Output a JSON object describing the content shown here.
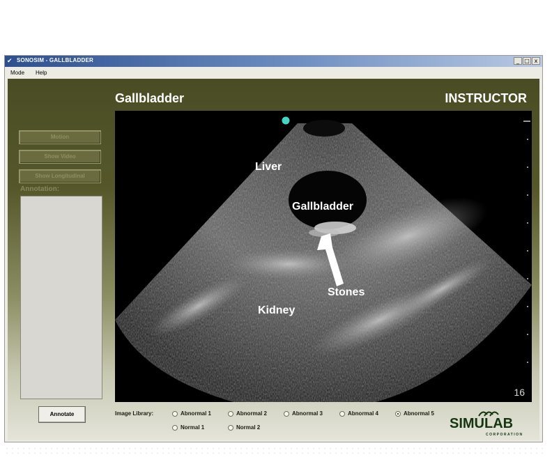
{
  "window": {
    "title": "SONOSIM - GALLBLADDER",
    "controls": {
      "minimize": "_",
      "maximize": "□",
      "close": "x"
    }
  },
  "menu": {
    "items": [
      "Mode",
      "Help"
    ]
  },
  "header": {
    "title": "Gallbladder",
    "mode": "INSTRUCTOR"
  },
  "sidebar": {
    "buttons": [
      "Motion",
      "Show Video",
      "Show Longitudinal"
    ],
    "annotation_label": "Annotation:"
  },
  "annotate_button": "Annotate",
  "ultrasound": {
    "labels": {
      "liver": "Liver",
      "gallbladder": "Gallbladder",
      "stones": "Stones",
      "kidney": "Kidney"
    },
    "frame_number": "16"
  },
  "image_library": {
    "label": "Image Library:",
    "options": [
      {
        "label": "Abnormal 1",
        "selected": false
      },
      {
        "label": "Abnormal 2",
        "selected": false
      },
      {
        "label": "Abnormal 3",
        "selected": false
      },
      {
        "label": "Abnormal 4",
        "selected": false
      },
      {
        "label": "Abnormal 5",
        "selected": true
      },
      {
        "label": "Normal 1",
        "selected": false
      },
      {
        "label": "Normal 2",
        "selected": false
      }
    ]
  },
  "logo": {
    "name": "SIMULAB",
    "sub": "CORPORATION"
  },
  "colors": {
    "panel": "#55572b",
    "title_bar": "#2c4f8f",
    "marker": "#44d6c2"
  }
}
